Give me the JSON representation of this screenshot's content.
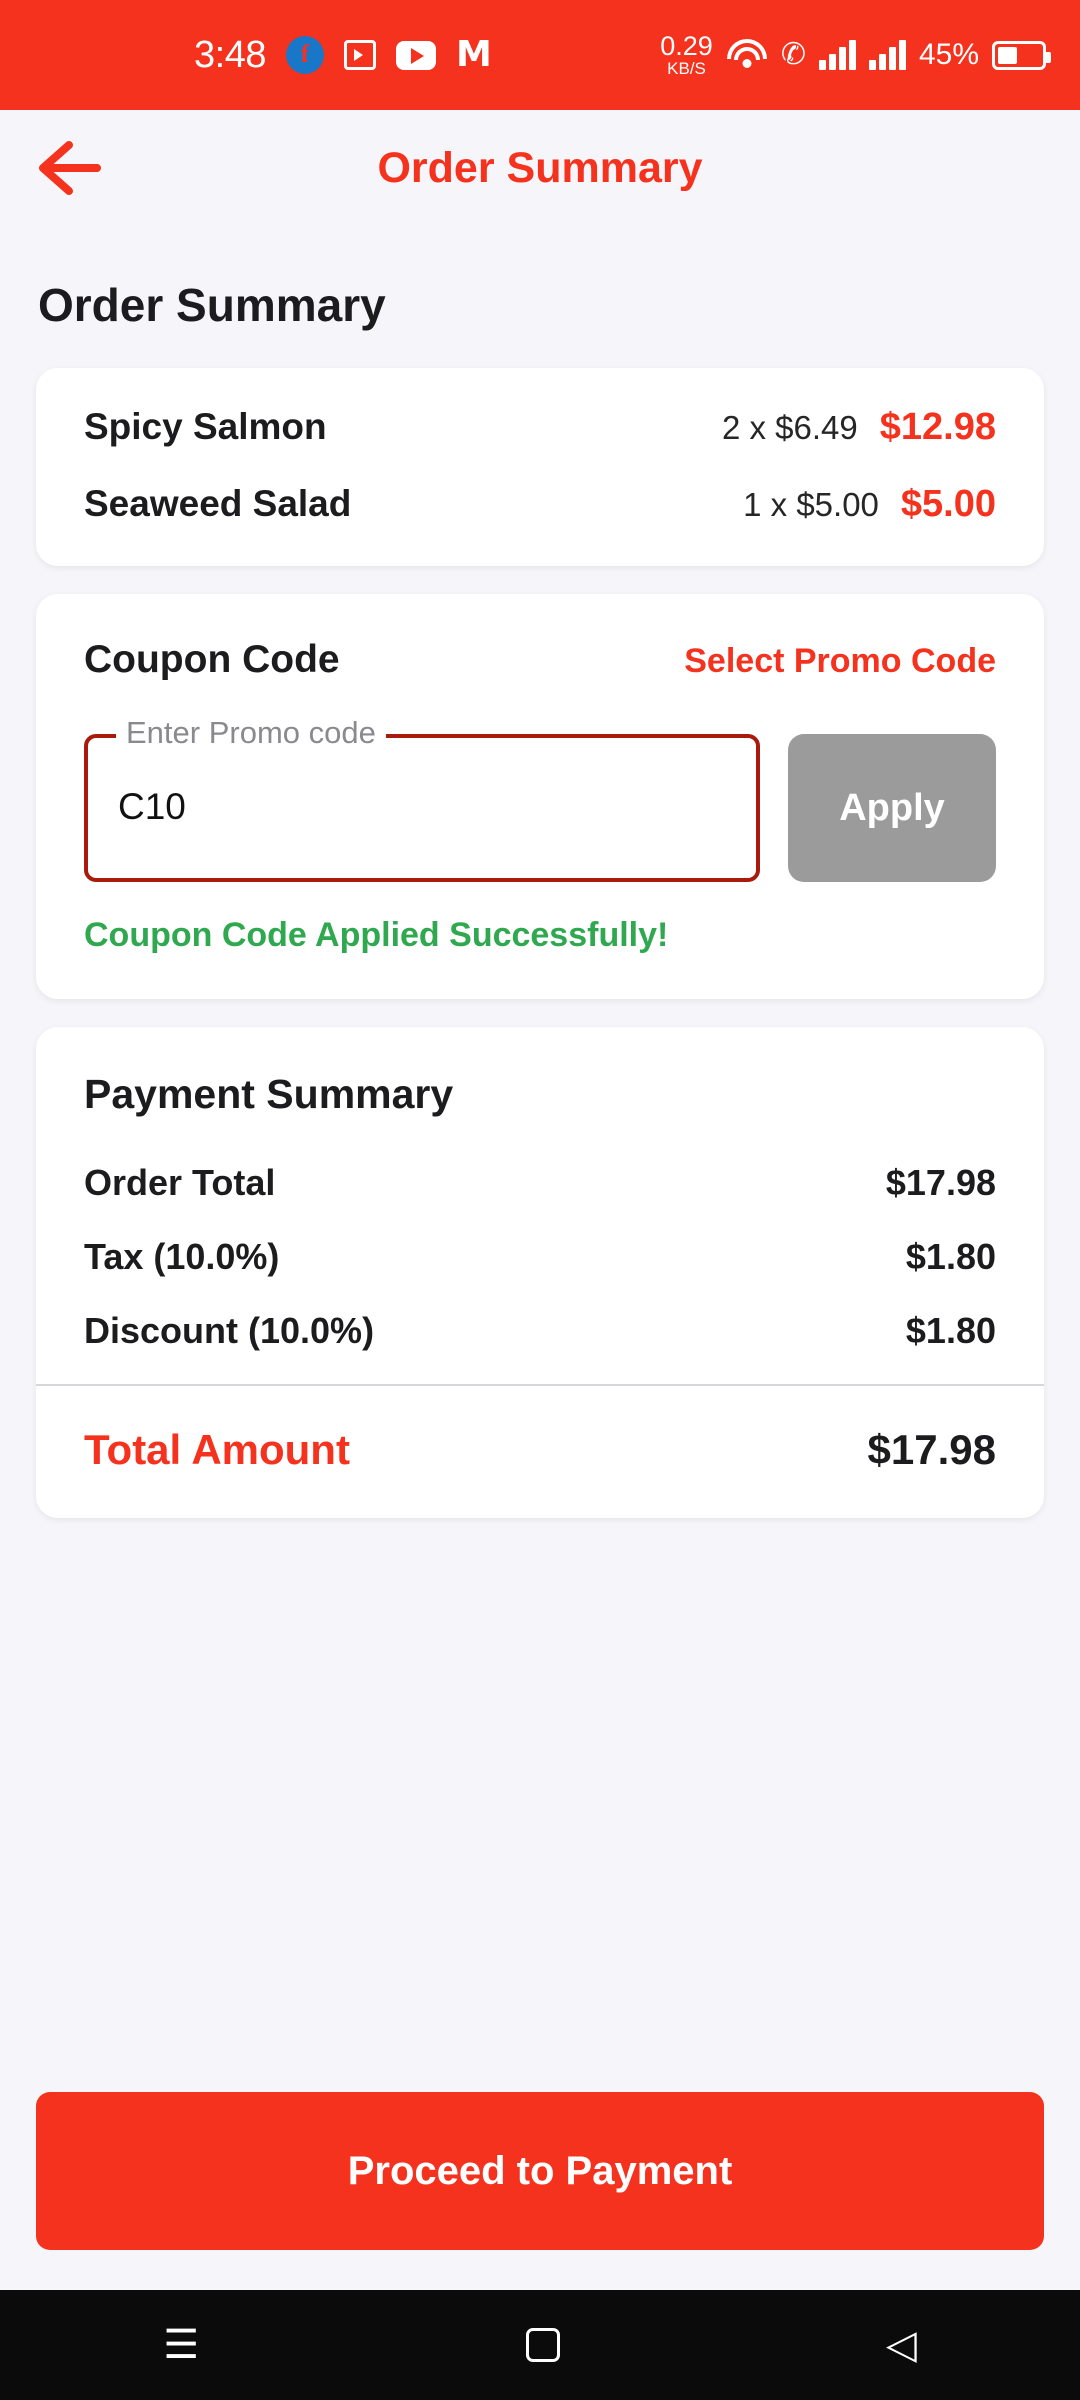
{
  "status_bar": {
    "time": "3:48",
    "network_speed_value": "0.29",
    "network_speed_unit": "KB/S",
    "battery_percent": "45%",
    "icons": [
      "facebook-icon",
      "video-camera-icon",
      "youtube-icon",
      "myntra-icon",
      "wifi-icon",
      "call-icon",
      "signal-bars-icon",
      "battery-icon"
    ],
    "background_color": "#F4321E"
  },
  "app_bar": {
    "back_label": "back-arrow",
    "title": "Order Summary"
  },
  "page": {
    "title": "Order Summary"
  },
  "order_items": {
    "rows": [
      {
        "name": "Spicy Salmon",
        "qty_price": "2 x $6.49",
        "total": "$12.98"
      },
      {
        "name": "Seaweed Salad",
        "qty_price": "1 x $5.00",
        "total": "$5.00"
      }
    ]
  },
  "coupon": {
    "title": "Coupon Code",
    "promo_link": "Select Promo Code",
    "field_label": "Enter Promo code",
    "field_value": "C10",
    "field_placeholder": "Enter Promo code",
    "apply_label": "Apply",
    "success_message": "Coupon Code Applied Successfully!",
    "success_color": "#2FA84F",
    "border_color": "#A81B0C",
    "apply_disabled_color": "#9B9B9B"
  },
  "payment_summary": {
    "title": "Payment Summary",
    "rows": [
      {
        "label": "Order Total",
        "value": "$17.98"
      },
      {
        "label": "Tax (10.0%)",
        "value": "$1.80"
      },
      {
        "label": "Discount (10.0%)",
        "value": "$1.80"
      }
    ],
    "total_label": "Total Amount",
    "total_value": "$17.98"
  },
  "cta": {
    "label": "Proceed to Payment"
  },
  "nav_bar": {
    "menu": "☰",
    "home": "home-square",
    "back": "◁"
  },
  "colors": {
    "brand_red": "#F4321E",
    "page_bg": "#F6F6FA",
    "card_bg": "#FFFFFF",
    "text_dark": "#1C1C1E"
  }
}
